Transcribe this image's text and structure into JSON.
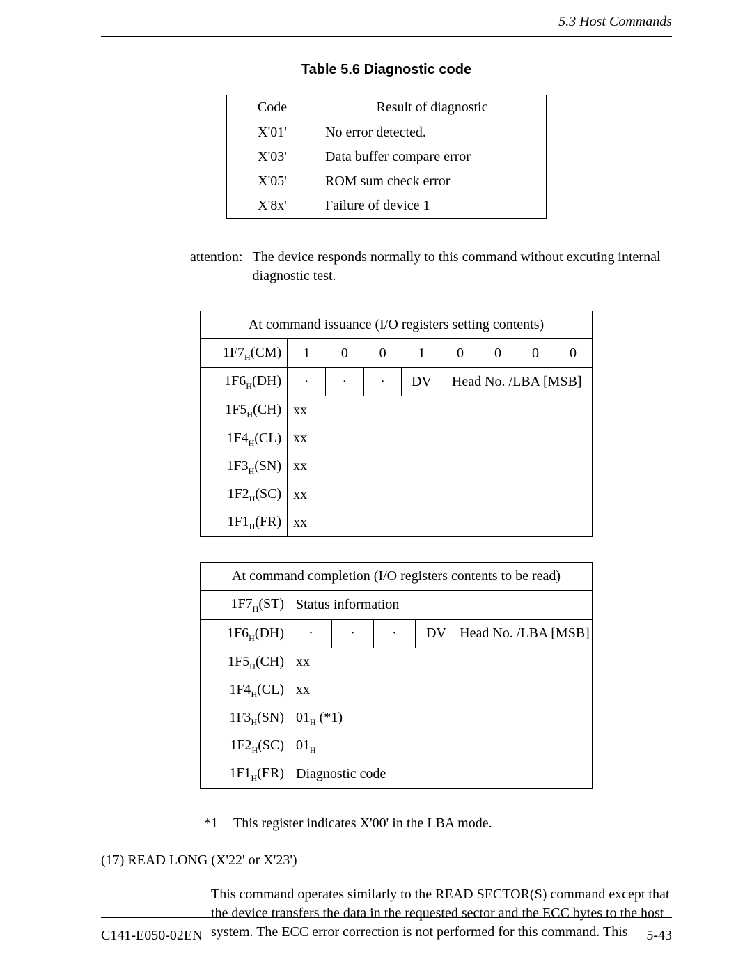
{
  "header": {
    "section": "5.3  Host Commands"
  },
  "table56": {
    "caption": "Table 5.6   Diagnostic code",
    "head": {
      "code": "Code",
      "result": "Result of diagnostic"
    },
    "rows": [
      {
        "code": "X'01'",
        "result": "No error detected."
      },
      {
        "code": "X'03'",
        "result": "Data buffer compare error"
      },
      {
        "code": "X'05'",
        "result": "ROM sum check error"
      },
      {
        "code": "X'8x'",
        "result": "Failure of device 1"
      }
    ]
  },
  "attention": {
    "label": "attention:",
    "text": "The device responds normally to this command without excuting internal diagnostic test."
  },
  "reg_issuance": {
    "title": "At command issuance (I/O registers setting contents)",
    "rows": {
      "cm": {
        "label_pre": "1F7",
        "label_sub": "H",
        "label_post": "(CM)",
        "bits": [
          "1",
          "0",
          "0",
          "1",
          "0",
          "0",
          "0",
          "0"
        ]
      },
      "dh": {
        "label_pre": "1F6",
        "label_sub": "H",
        "label_post": "(DH)",
        "dots": [
          "·",
          "·",
          "·"
        ],
        "dv": "DV",
        "head": "Head No. /LBA [MSB]"
      },
      "ch": {
        "label_pre": "1F5",
        "label_sub": "H",
        "label_post": "(CH)",
        "val": "xx"
      },
      "cl": {
        "label_pre": "1F4",
        "label_sub": "H",
        "label_post": "(CL)",
        "val": "xx"
      },
      "sn": {
        "label_pre": "1F3",
        "label_sub": "H",
        "label_post": "(SN)",
        "val": "xx"
      },
      "sc": {
        "label_pre": "1F2",
        "label_sub": "H",
        "label_post": "(SC)",
        "val": "xx"
      },
      "fr": {
        "label_pre": "1F1",
        "label_sub": "H",
        "label_post": "(FR)",
        "val": "xx"
      }
    }
  },
  "reg_completion": {
    "title": "At command completion (I/O registers contents to be read)",
    "rows": {
      "st": {
        "label_pre": "1F7",
        "label_sub": "H",
        "label_post": "(ST)",
        "val": "Status information"
      },
      "dh": {
        "label_pre": "1F6",
        "label_sub": "H",
        "label_post": "(DH)",
        "dots": [
          "·",
          "·",
          "·"
        ],
        "dv": "DV",
        "head": "Head No. /LBA [MSB]"
      },
      "ch": {
        "label_pre": "1F5",
        "label_sub": "H",
        "label_post": "(CH)",
        "val": "xx"
      },
      "cl": {
        "label_pre": "1F4",
        "label_sub": "H",
        "label_post": "(CL)",
        "val": "xx"
      },
      "sn": {
        "label_pre": "1F3",
        "label_sub": "H",
        "label_post": "(SN)",
        "val_pre": "01",
        "val_sub": "H",
        "val_post": " (*1)"
      },
      "sc": {
        "label_pre": "1F2",
        "label_sub": "H",
        "label_post": "(SC)",
        "val_pre": "01",
        "val_sub": "H",
        "val_post": ""
      },
      "er": {
        "label_pre": "1F1",
        "label_sub": "H",
        "label_post": "(ER)",
        "val": "Diagnostic code"
      }
    }
  },
  "note": {
    "label": "*1",
    "text": "This register indicates X'00' in the LBA mode."
  },
  "section": {
    "head": "(17)  READ LONG (X'22' or X'23')",
    "body": "This command operates similarly to the READ SECTOR(S) command except that the device transfers the data in the requested sector and the ECC bytes to the host system. The ECC error correction is not performed for this command. This"
  },
  "footer": {
    "doc": "C141-E050-02EN",
    "page": "5-43"
  }
}
